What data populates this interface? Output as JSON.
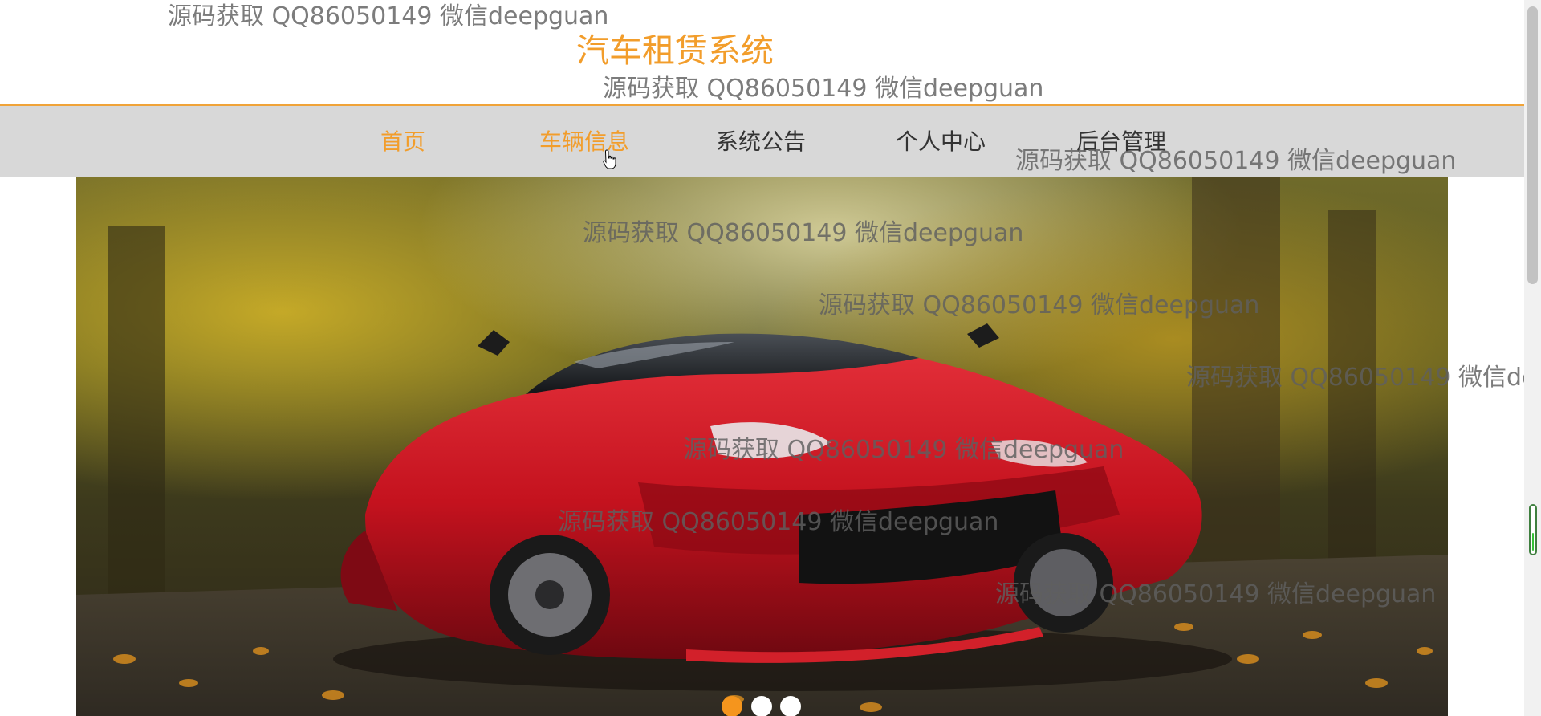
{
  "header": {
    "title": "汽车租赁系统"
  },
  "nav": {
    "items": [
      {
        "label": "首页"
      },
      {
        "label": "车辆信息"
      },
      {
        "label": "系统公告"
      },
      {
        "label": "个人中心"
      },
      {
        "label": "后台管理"
      }
    ]
  },
  "banner": {
    "carousel": {
      "slides": 3,
      "active": 1
    }
  },
  "watermark": {
    "text": "源码获取 QQ86050149 微信deepguan"
  },
  "colors": {
    "accent": "#f29d2b",
    "nav_background": "#d8d8d8",
    "dot_active": "#f5951d"
  },
  "icons": {
    "cursor": "hand-pointer-icon"
  }
}
